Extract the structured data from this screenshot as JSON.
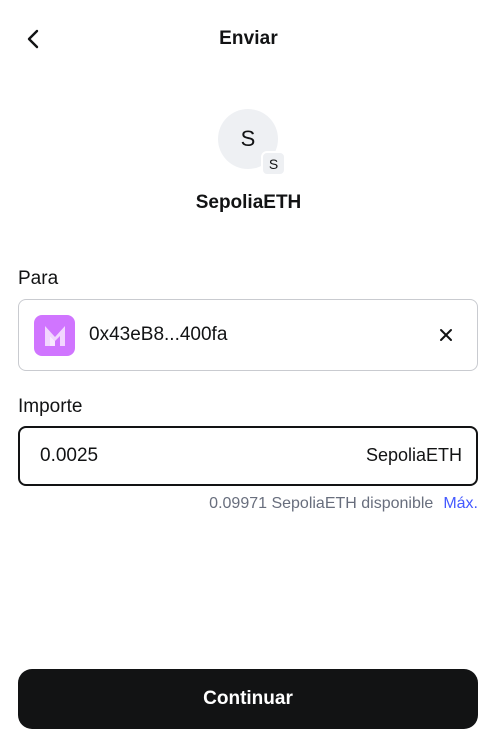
{
  "header": {
    "title": "Enviar",
    "back_icon": "chevron-left-icon"
  },
  "token": {
    "avatar_letter": "S",
    "network_letter": "S",
    "name": "SepoliaETH"
  },
  "to": {
    "label": "Para",
    "address": "0x43eB8...400fa",
    "account_icon": "metamask-logo-icon",
    "account_color": "#d075ff",
    "clear_icon": "close-icon"
  },
  "amount": {
    "label": "Importe",
    "value": "0.0025",
    "unit": "SepoliaETH",
    "balance": "0.09971 SepoliaETH disponible",
    "max_label": "Máx."
  },
  "footer": {
    "continue_label": "Continuar"
  },
  "colors": {
    "accent": "#4459ff",
    "primary_button": "#121314",
    "muted_text": "#686e7d"
  }
}
